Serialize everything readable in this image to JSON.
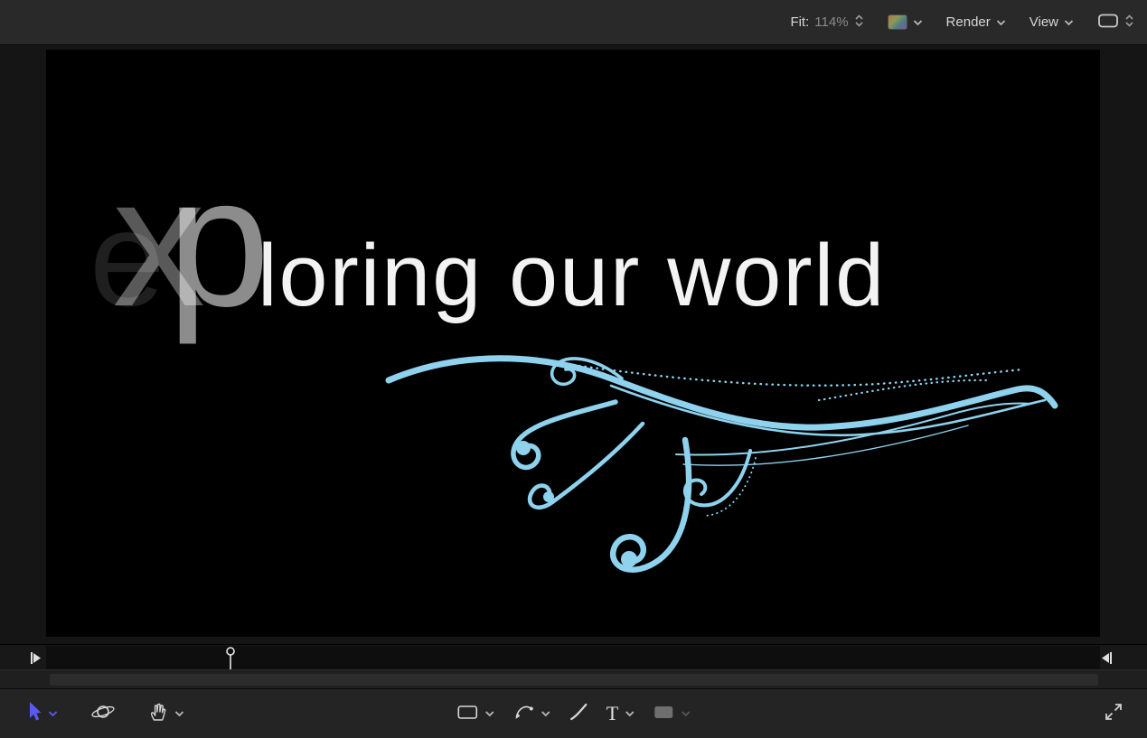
{
  "top_toolbar": {
    "fit_label": "Fit:",
    "zoom_value": "114%",
    "render_label": "Render",
    "view_label": "View",
    "icons": [
      "zoom-stepper-icon",
      "color-swatch-icon",
      "chevron-down-icon",
      "display-layout-icon",
      "layout-stepper-icon"
    ]
  },
  "canvas": {
    "title": {
      "segments": [
        {
          "text": "e"
        },
        {
          "text": "x"
        },
        {
          "text": "p"
        },
        {
          "text": "loring our world"
        }
      ]
    },
    "flourish": {
      "name": "flourish-swirl-graphic",
      "color": "#8ed2ee"
    }
  },
  "timeline": {
    "markers": [
      "play-range-start-marker",
      "playhead",
      "play-range-end-marker"
    ]
  },
  "bottom_toolbar": {
    "text_tool_glyph": "T",
    "tools": [
      {
        "name": "select-transform-tool",
        "state": "selected"
      },
      {
        "name": "3d-transform-tool",
        "state": "normal"
      },
      {
        "name": "pan-zoom-tool",
        "state": "normal"
      },
      {
        "name": "rectangle-tool",
        "state": "normal"
      },
      {
        "name": "bezier-tool",
        "state": "normal"
      },
      {
        "name": "paint-stroke-tool",
        "state": "normal"
      },
      {
        "name": "text-tool",
        "state": "normal"
      },
      {
        "name": "mask-tool",
        "state": "disabled"
      },
      {
        "name": "fullscreen-tool",
        "state": "normal"
      }
    ]
  },
  "colors": {
    "accent_blue": "#585af6",
    "flourish_blue": "#8ed2ee",
    "toolbar_bg": "#292929",
    "canvas_bg": "#000000"
  }
}
